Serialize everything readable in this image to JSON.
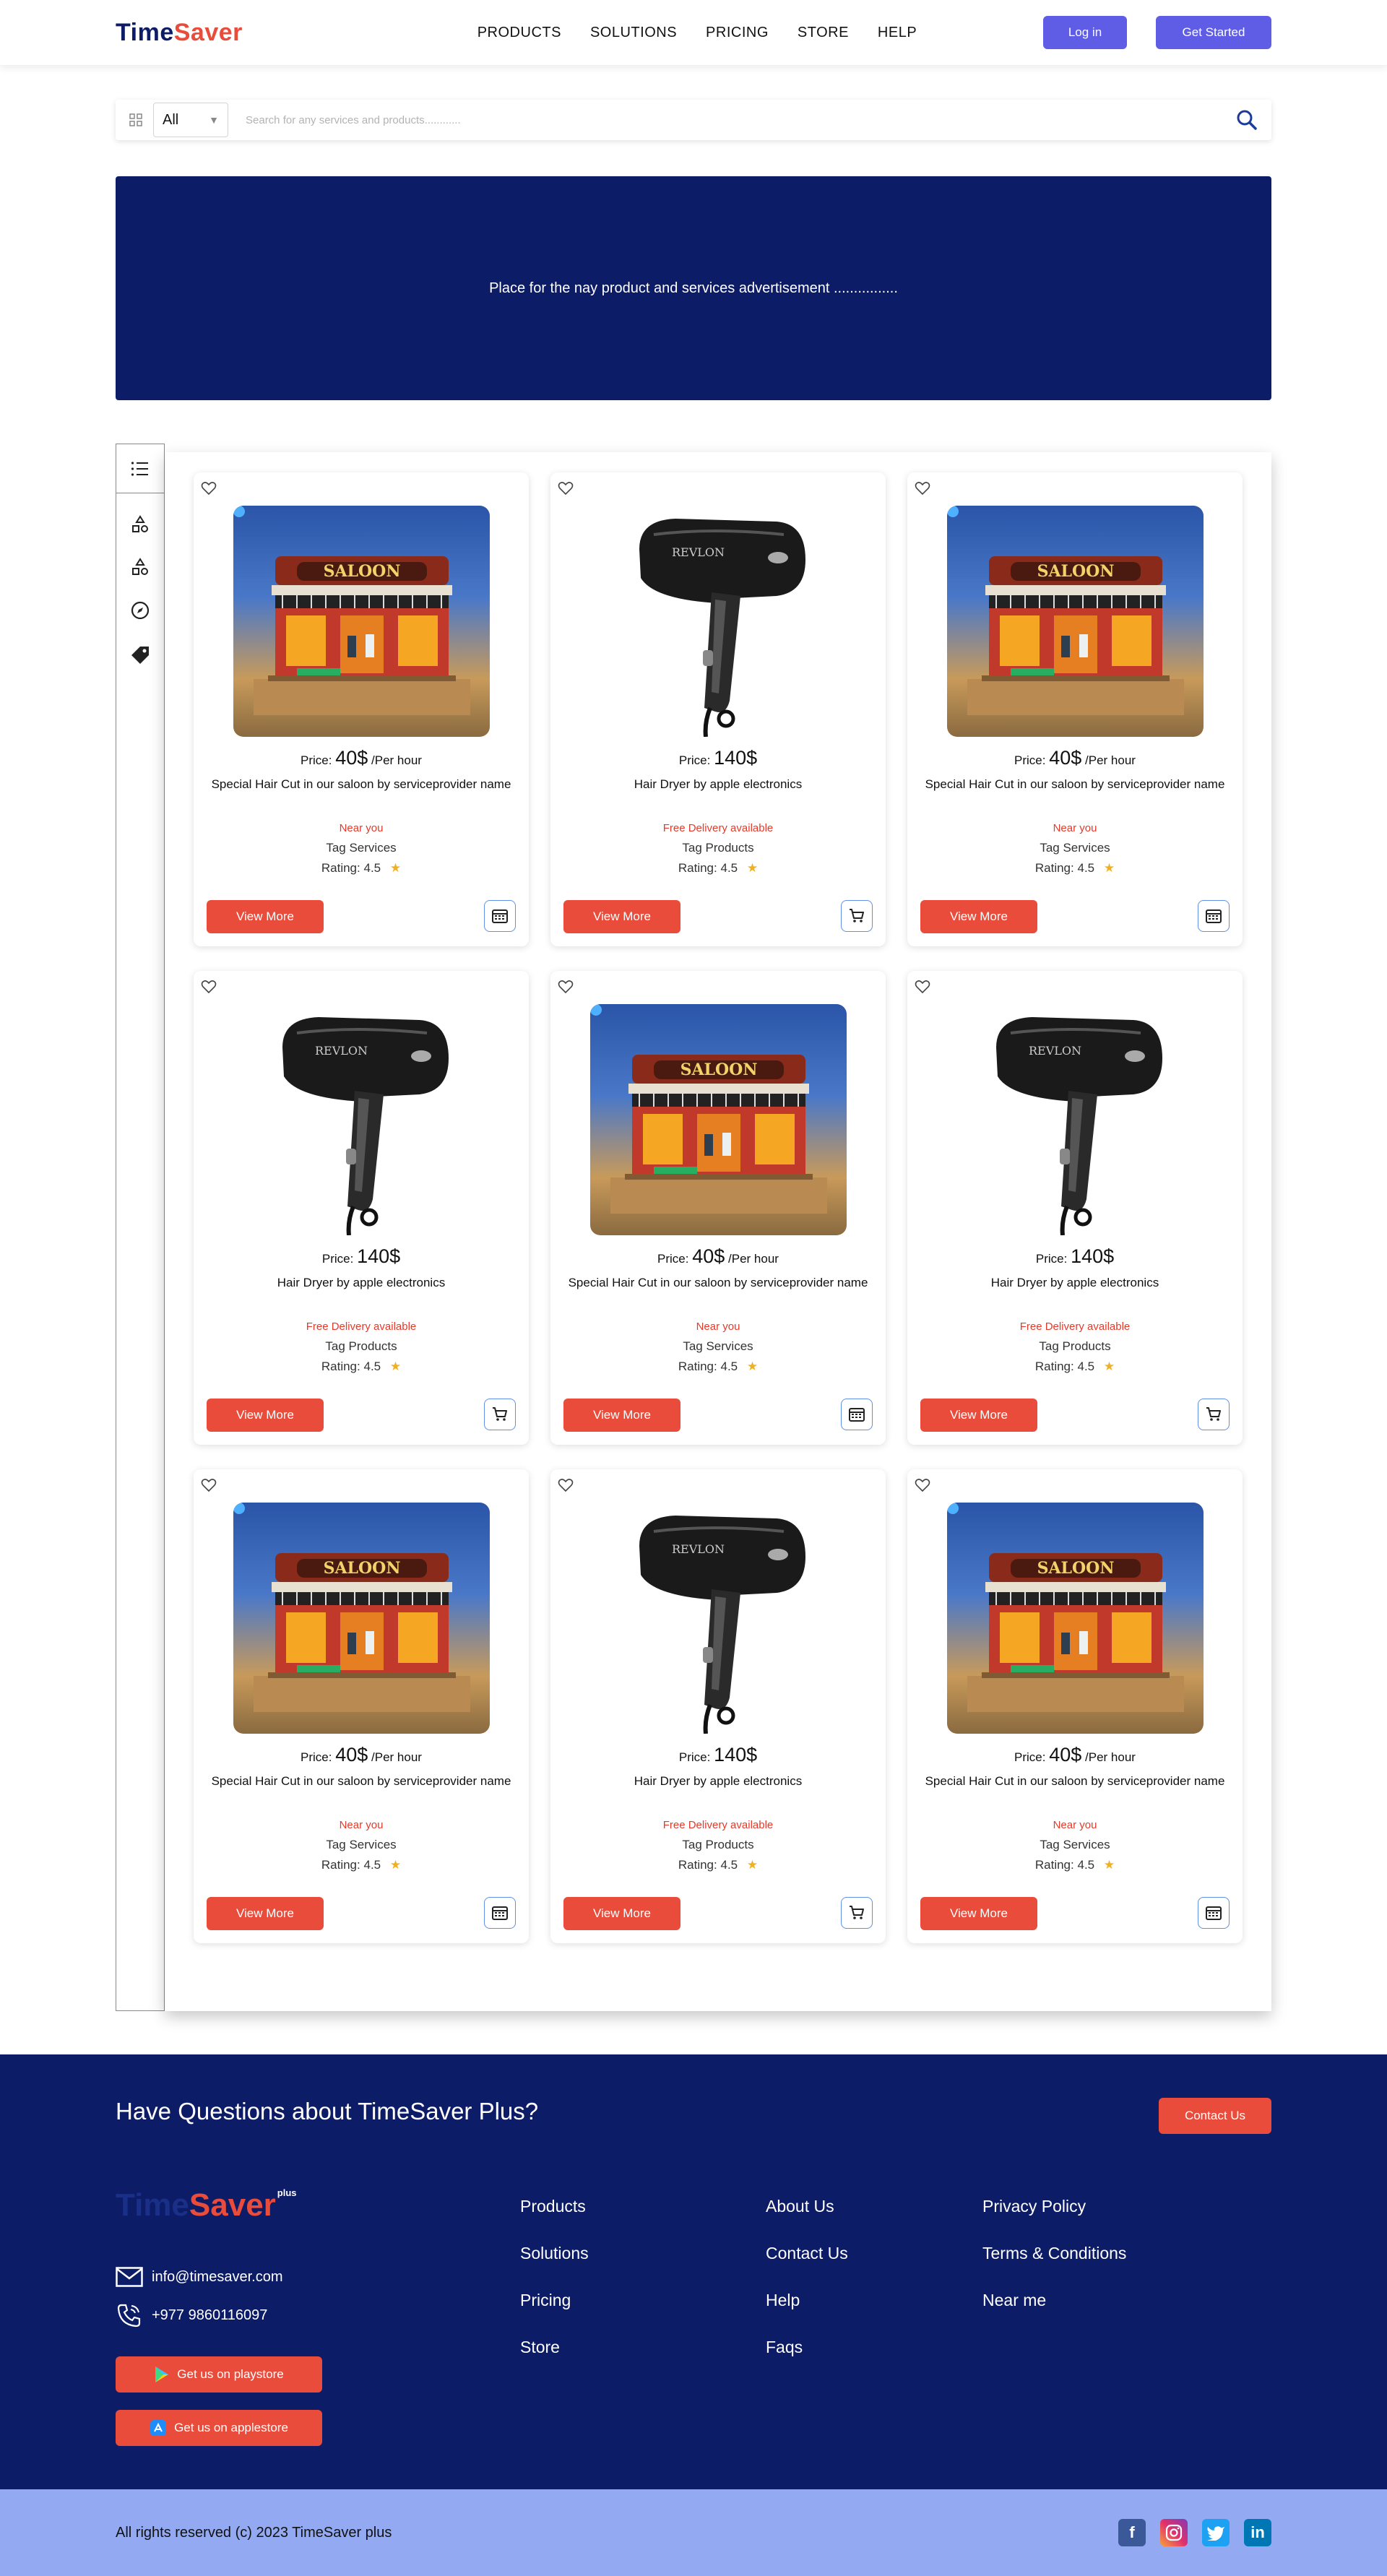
{
  "brand": {
    "logo_time": "Time",
    "logo_saver": "Saver",
    "plus": "plus"
  },
  "nav": [
    "PRODUCTS",
    "SOLUTIONS",
    "PRICING",
    "STORE",
    "HELP"
  ],
  "auth": {
    "login": "Log in",
    "get_started": "Get Started"
  },
  "search": {
    "category": "All",
    "placeholder": "Search for any services and products............"
  },
  "ad": {
    "text": "Place for the nay product and services advertisement ................"
  },
  "products": [
    {
      "image": "saloon",
      "price_prefix": "Price:",
      "price": "40$",
      "unit": "/Per hour",
      "title": "Special Hair Cut in our saloon by serviceprovider name",
      "tagline": "Near you",
      "tag": "Tag Services",
      "rating_label": "Rating:",
      "rating": "4.5",
      "view": "View More",
      "action_icon": "calendar-icon"
    },
    {
      "image": "dryer",
      "price_prefix": "Price:",
      "price": "140$",
      "unit": "",
      "title": "Hair Dryer by apple electronics",
      "tagline": "Free Delivery available",
      "tag": "Tag Products",
      "rating_label": "Rating:",
      "rating": "4.5",
      "view": "View More",
      "action_icon": "cart-icon"
    },
    {
      "image": "saloon",
      "price_prefix": "Price:",
      "price": "40$",
      "unit": "/Per hour",
      "title": "Special Hair Cut in our saloon by serviceprovider name",
      "tagline": "Near you",
      "tag": "Tag Services",
      "rating_label": "Rating:",
      "rating": "4.5",
      "view": "View More",
      "action_icon": "calendar-icon"
    },
    {
      "image": "dryer",
      "price_prefix": "Price:",
      "price": "140$",
      "unit": "",
      "title": "Hair Dryer by apple electronics",
      "tagline": "Free Delivery available",
      "tag": "Tag Products",
      "rating_label": "Rating:",
      "rating": "4.5",
      "view": "View More",
      "action_icon": "cart-icon"
    },
    {
      "image": "saloon",
      "price_prefix": "Price:",
      "price": "40$",
      "unit": "/Per hour",
      "title": "Special Hair Cut in our saloon by serviceprovider name",
      "tagline": "Near you",
      "tag": "Tag Services",
      "rating_label": "Rating:",
      "rating": "4.5",
      "view": "View More",
      "action_icon": "calendar-icon"
    },
    {
      "image": "dryer",
      "price_prefix": "Price:",
      "price": "140$",
      "unit": "",
      "title": "Hair Dryer by apple electronics",
      "tagline": "Free Delivery available",
      "tag": "Tag Products",
      "rating_label": "Rating:",
      "rating": "4.5",
      "view": "View More",
      "action_icon": "cart-icon"
    },
    {
      "image": "saloon",
      "price_prefix": "Price:",
      "price": "40$",
      "unit": "/Per hour",
      "title": "Special Hair Cut in our saloon by serviceprovider name",
      "tagline": "Near you",
      "tag": "Tag Services",
      "rating_label": "Rating:",
      "rating": "4.5",
      "view": "View More",
      "action_icon": "calendar-icon"
    },
    {
      "image": "dryer",
      "price_prefix": "Price:",
      "price": "140$",
      "unit": "",
      "title": "Hair Dryer by apple electronics",
      "tagline": "Free Delivery available",
      "tag": "Tag Products",
      "rating_label": "Rating:",
      "rating": "4.5",
      "view": "View More",
      "action_icon": "cart-icon"
    },
    {
      "image": "saloon",
      "price_prefix": "Price:",
      "price": "40$",
      "unit": "/Per hour",
      "title": "Special Hair Cut in our saloon by serviceprovider name",
      "tagline": "Near you",
      "tag": "Tag Services",
      "rating_label": "Rating:",
      "rating": "4.5",
      "view": "View More",
      "action_icon": "calendar-icon"
    }
  ],
  "footer": {
    "question": "Have Questions about TimeSaver Plus?",
    "contact_btn": "Contact Us",
    "email": "info@timesaver.com",
    "phone": "+977 9860116097",
    "playstore": "Get us on playstore",
    "applestore": "Get us on applestore",
    "col1": [
      "Products",
      "Solutions",
      "Pricing",
      "Store"
    ],
    "col2": [
      "About Us",
      "Contact Us",
      "Help",
      "Faqs"
    ],
    "col3": [
      "Privacy Policy",
      "Terms & Conditions",
      "Near me"
    ],
    "copyright": "All rights reserved (c) 2023 TimeSaver plus"
  },
  "colors": {
    "navy": "#0d1c66",
    "accent_red": "#ea4c3c",
    "purple": "#5f5ce6",
    "bottom_bar": "#93aaf2"
  }
}
